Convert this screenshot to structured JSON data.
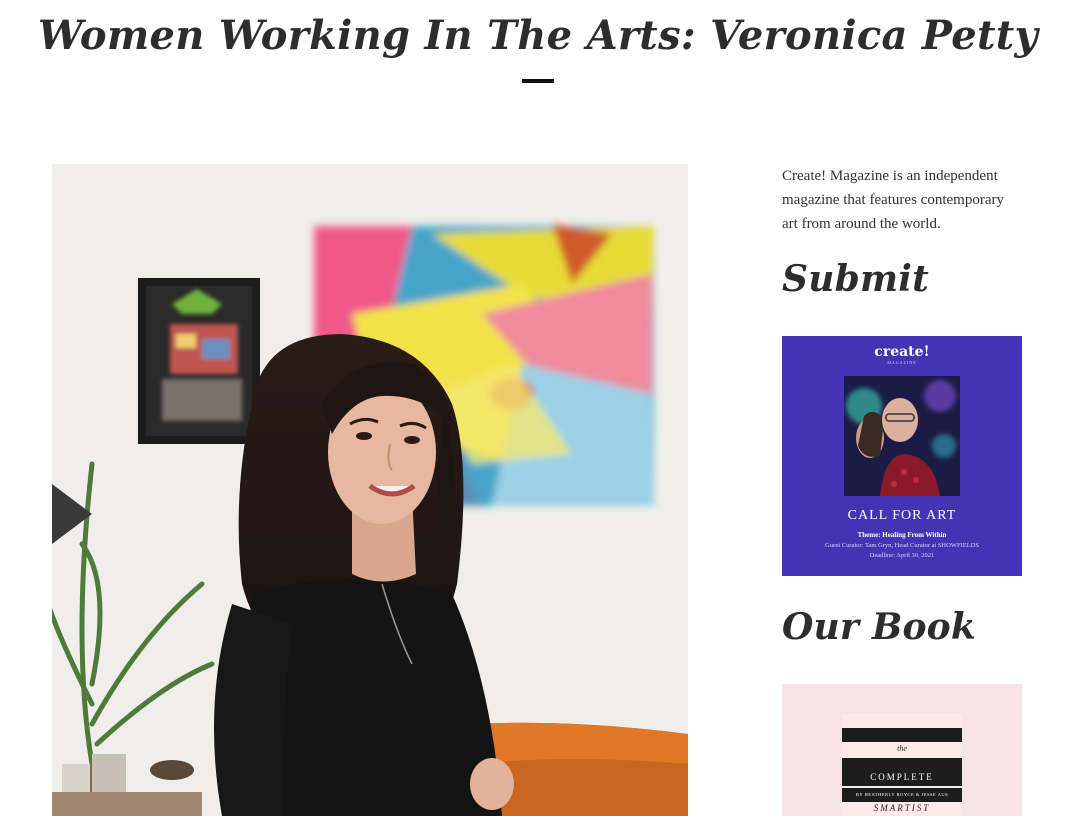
{
  "post": {
    "title": "Women Working In The Arts: Veronica Petty"
  },
  "sidebar": {
    "about": "Create! Magazine is an independent magazine that features contemporary art from around the world.",
    "submit_heading": "Submit",
    "book_heading": "Our Book",
    "call_card": {
      "brand": "create!",
      "brand_sub": "MAGAZINE",
      "title": "CALL FOR ART",
      "theme": "Theme: Healing From Within",
      "curator": "Guest Curator: Tam Gryn, Head Curator at SHOWFIELDS",
      "deadline": "Deadline: April 30, 2021",
      "bg_color": "#4433b3"
    },
    "book_card": {
      "the": "the",
      "complete": "COMPLETE",
      "authors": "BY HEATHERLY ROYCE & JESSE AUS",
      "smartist": "SMARTIST",
      "bg_color": "#f6e4e3"
    }
  },
  "colors": {
    "title": "#2d2d2d",
    "rule": "#111111"
  }
}
